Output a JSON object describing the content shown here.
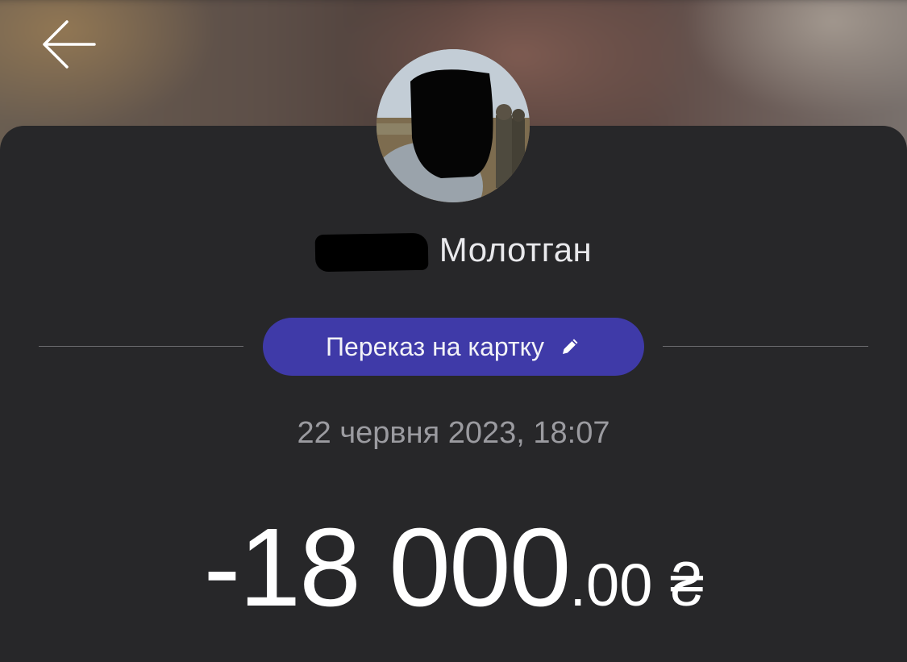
{
  "header": {
    "back_icon": "arrow-left-icon"
  },
  "recipient": {
    "name_visible": "Молотган",
    "avatar": "avatar-photo"
  },
  "transfer": {
    "type_label": "Переказ на картку",
    "edit_icon": "pencil-icon",
    "chip_color": "#3f3aa8",
    "datetime": "22 червня 2023, 18:07"
  },
  "amount": {
    "major": "-18 000",
    "minor": ".00",
    "currency": "₴"
  }
}
